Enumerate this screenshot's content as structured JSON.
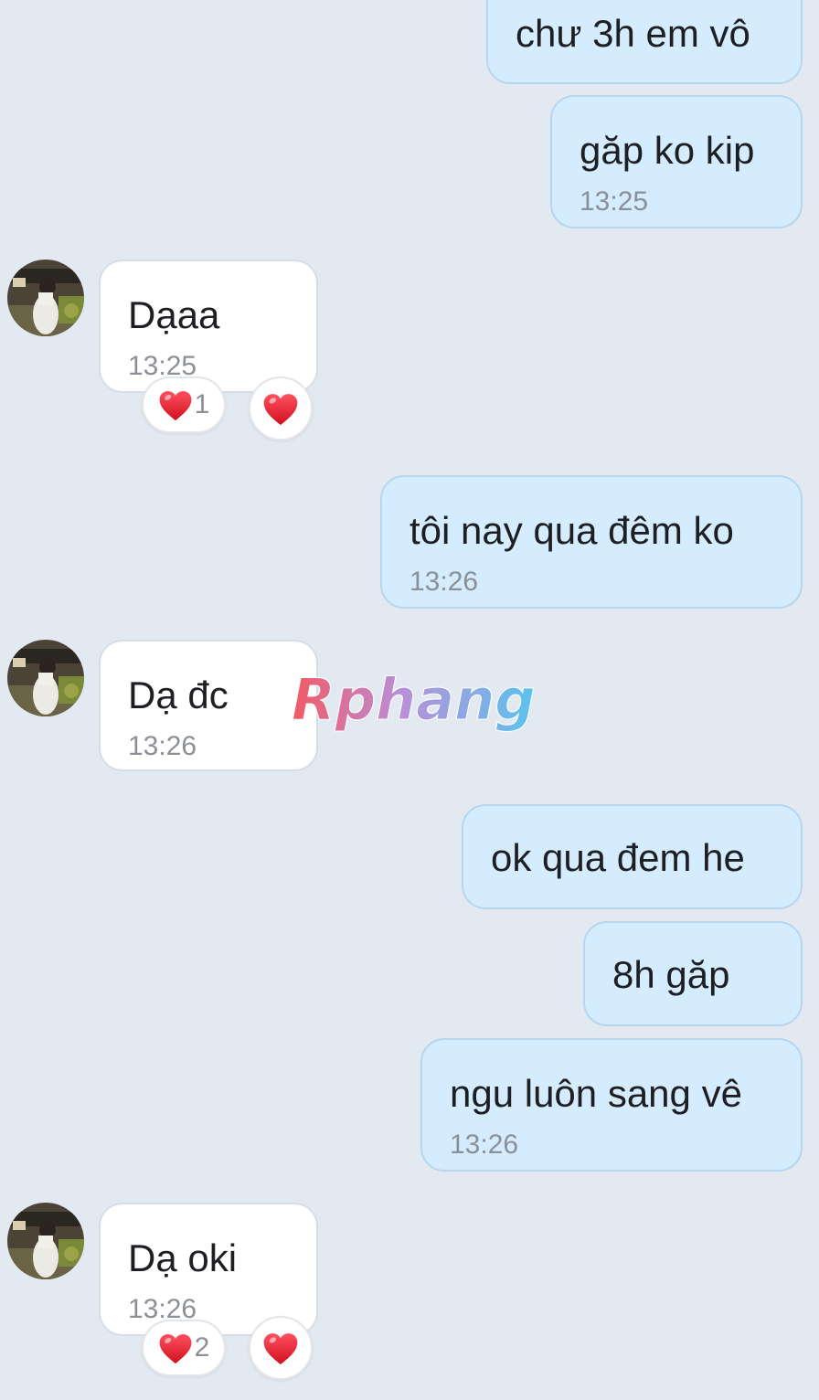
{
  "conversation": {
    "messages": [
      {
        "text": "chư 3h em vô",
        "time": ""
      },
      {
        "text": "găp ko kip",
        "time": "13:25"
      },
      {
        "text": "Dạaa",
        "time": "13:25",
        "reaction_count": "1"
      },
      {
        "text": "tôi nay qua đêm ko",
        "time": "13:26"
      },
      {
        "text": "Dạ đc",
        "time": "13:26"
      },
      {
        "text": "ok qua đem he",
        "time": ""
      },
      {
        "text": "8h găp",
        "time": ""
      },
      {
        "text": "ngu luôn sang vê",
        "time": "13:26"
      },
      {
        "text": "Dạ oki",
        "time": "13:26",
        "reaction_count": "2"
      }
    ]
  },
  "watermark": {
    "text": "Rphang"
  },
  "icons": {
    "reaction": "heart-icon",
    "avatar": "contact-avatar"
  },
  "colors": {
    "background": "#e3e9f1",
    "sent_bubble": "#d4ecfd",
    "received_bubble": "#ffffff",
    "heart": "#e0202e"
  }
}
